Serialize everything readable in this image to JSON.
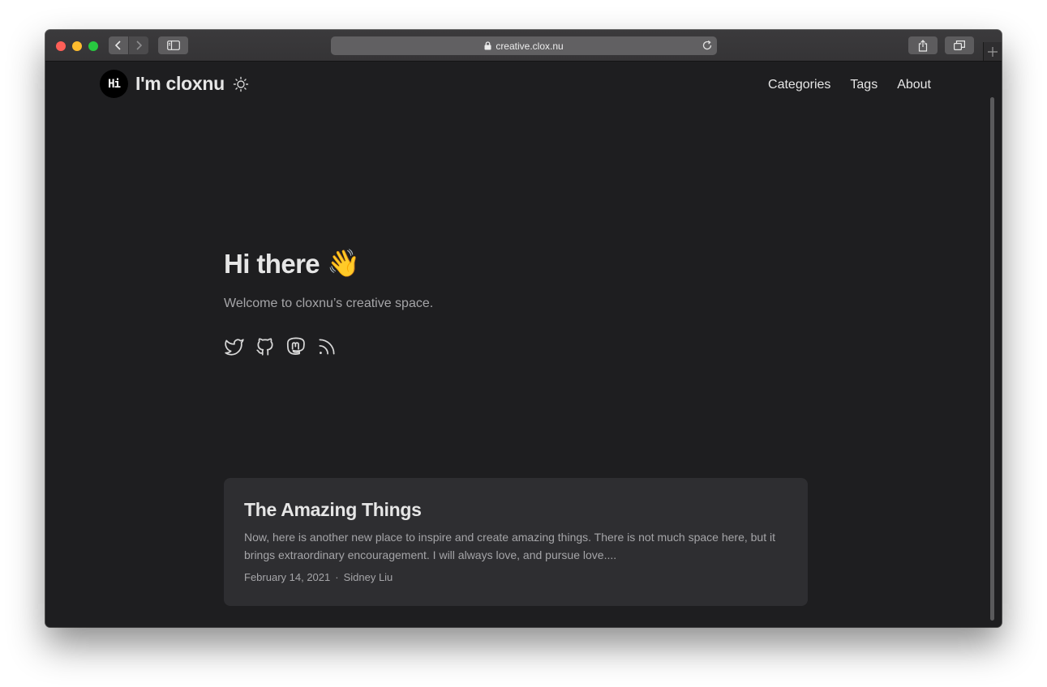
{
  "browser": {
    "url": "creative.clox.nu"
  },
  "header": {
    "logo_text": "Hi",
    "site_name": "I'm cloxnu",
    "nav": [
      "Categories",
      "Tags",
      "About"
    ]
  },
  "hero": {
    "title": "Hi there",
    "emoji": "👋",
    "subtitle": "Welcome to cloxnu’s creative space."
  },
  "socials": [
    "twitter-icon",
    "github-icon",
    "mastodon-icon",
    "rss-icon"
  ],
  "post": {
    "title": "The Amazing Things",
    "excerpt": "Now, here is another new place to inspire and create amazing things. There is not much space here, but it brings extraordinary encouragement. I will always love, and pursue love....",
    "date": "February 14, 2021",
    "separator": "·",
    "author": "Sidney Liu"
  },
  "colors": {
    "background": "#1e1e20",
    "card": "#2e2e31",
    "text_primary": "#e6e6e6",
    "text_secondary": "#a5a5a8"
  }
}
